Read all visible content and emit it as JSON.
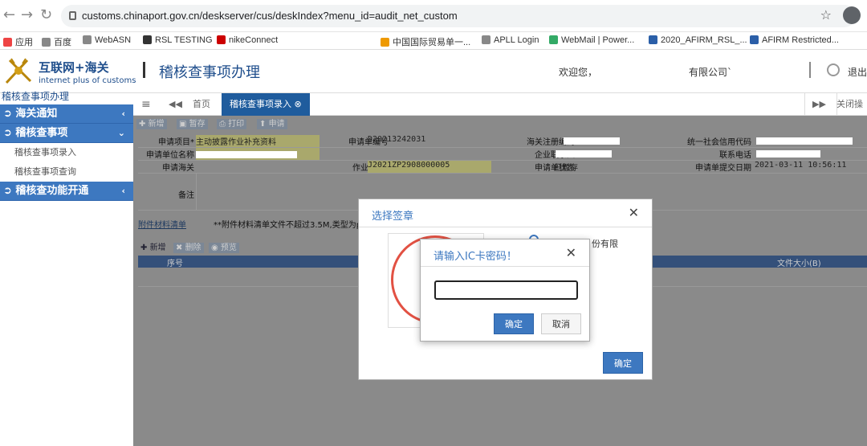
{
  "browser": {
    "url": "customs.chinaport.gov.cn/deskserver/cus/deskIndex?menu_id=audit_net_custom",
    "bookmarks": [
      "应用",
      "百度",
      "WebASN",
      "RSL TESTING",
      "nikeConnect",
      "中国国际贸易单一...",
      "APLL Login",
      "WebMail | Power...",
      "2020_AFIRM_RSL_...",
      "AFIRM Restricted..."
    ]
  },
  "header": {
    "logo_title": "互联网+海关",
    "logo_subtitle": "internet plus of customs",
    "page_title": "稽核查事项办理",
    "welcome": "欢迎您，",
    "company": "有限公司`",
    "logout": "退出"
  },
  "sidebar": {
    "heading": "稽核查事项办理",
    "menu": [
      {
        "label": "海关通知",
        "chevron": "‹"
      },
      {
        "label": "稽核查事项",
        "chevron": "⌄"
      },
      {
        "label": "稽核查功能开通",
        "chevron": "‹"
      }
    ],
    "sub_items": [
      "稽核查事项录入",
      "稽核查事项查询"
    ]
  },
  "tabs": {
    "home": "首页",
    "active": "稽核查事项录入",
    "close_ops": "关闭操作"
  },
  "toolbar": {
    "new": "新增",
    "save": "暂存",
    "print": "打印",
    "apply": "申请"
  },
  "form": {
    "r1": {
      "l1": "申请项目*",
      "v1": "主动披露作业补充资料",
      "l2": "申请单编号",
      "v2": "D20213242031",
      "l3": "海关注册编码",
      "l4": "统一社会信用代码"
    },
    "r2": {
      "l1": "申请单位名称",
      "l3": "企业联系人",
      "l4": "联系电话"
    },
    "r3": {
      "l1": "申请海关",
      "l2": "作业编号*",
      "v2": "J2021ZP2908000005",
      "l3": "申请单状态",
      "v3": "已暂存",
      "l4": "申请单提交日期",
      "v4": "2021-03-11 10:56:11"
    },
    "r4": {
      "l1": "备注"
    }
  },
  "attachments": {
    "section": "附件材料清单",
    "note": "**附件材料清单文件不超过3.5M,类型为p",
    "new": "新增",
    "delete": "删除",
    "preview": "预览",
    "col_index": "序号",
    "col_size": "文件大小(B)"
  },
  "dialog_seal": {
    "title": "选择签章",
    "company_partial": "份有限",
    "ok": "确定"
  },
  "dialog_pwd": {
    "title": "请输入IC卡密码！",
    "ok": "确定",
    "cancel": "取消"
  }
}
